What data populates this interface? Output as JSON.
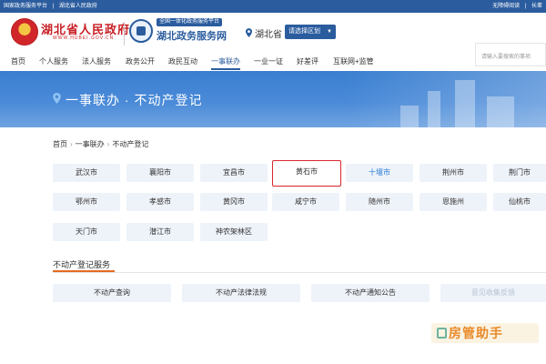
{
  "topbar": {
    "left_links": [
      "国家政务服务平台",
      "湖北省人民政府"
    ],
    "right_links": [
      "无障碍阅读",
      "长辈"
    ]
  },
  "header": {
    "gov_title": "湖北省人民政府",
    "gov_sub": "WWW.HUBEI.GOV.CN",
    "svc_tag": "全国一体化政务服务平台",
    "svc_name": "湖北政务服务网",
    "location": "湖北省",
    "region_select": "请选择区划"
  },
  "nav": {
    "items": [
      "首页",
      "个人服务",
      "法人服务",
      "政务公开",
      "政民互动",
      "一事联办",
      "一业一证",
      "好差评",
      "互联网+监管"
    ],
    "active_index": 5
  },
  "search": {
    "placeholder": "请输入要搜索的事项"
  },
  "banner": {
    "title": "一事联办 · 不动产登记"
  },
  "breadcrumb": [
    "首页",
    "一事联办",
    "不动产登记"
  ],
  "cities": [
    "武汉市",
    "襄阳市",
    "宜昌市",
    "黄石市",
    "十堰市",
    "荆州市",
    "荆门市",
    "鄂州市",
    "孝感市",
    "黄冈市",
    "咸宁市",
    "随州市",
    "恩施州",
    "仙桃市",
    "天门市",
    "潜江市",
    "神农架林区"
  ],
  "selected_city": "黄石市",
  "highlight_city": "十堰市",
  "service_section": {
    "title": "不动产登记服务",
    "buttons": [
      "不动产查询",
      "不动产法律法规",
      "不动产通知公告",
      "意见收集反馈"
    ]
  },
  "watermark": "房管助手",
  "colors": {
    "primary": "#2b5c9e",
    "banner": "#4a8ad8",
    "selected_border": "#d9262c",
    "accent_underline": "#e36b1f",
    "tile_bg": "#eef3fa"
  }
}
